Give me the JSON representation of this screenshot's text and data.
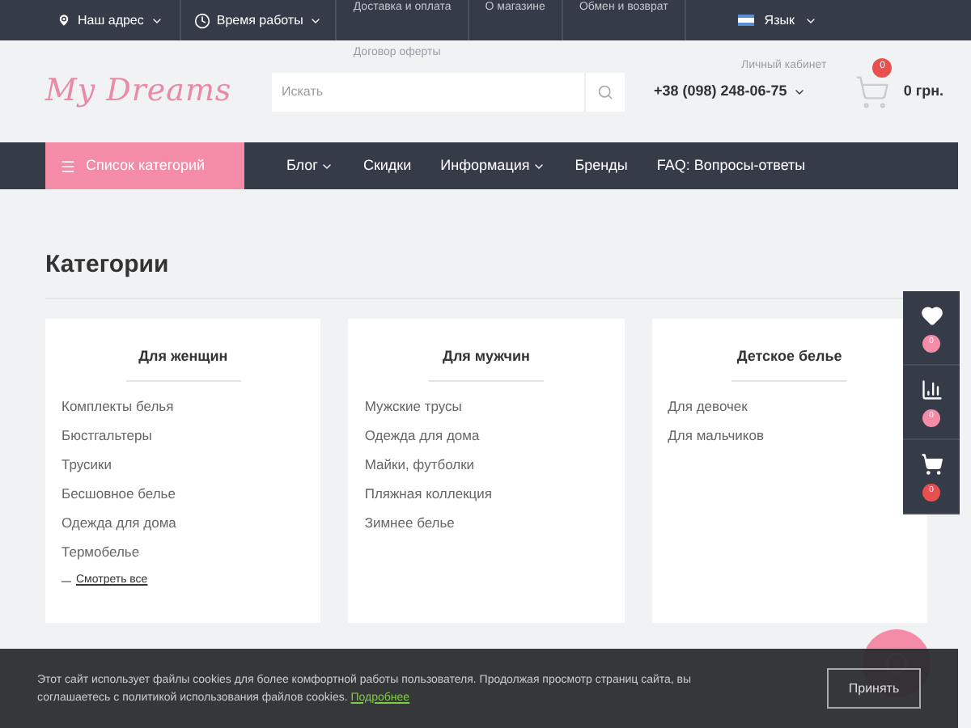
{
  "top_bar": {
    "address": "Наш адрес",
    "hours": "Время работы",
    "links": [
      "Доставка и оплата",
      "О магазине",
      "Обмен и возврат"
    ],
    "overflow_link": "Договор оферты",
    "language": "Язык"
  },
  "header": {
    "logo": "My Dreams",
    "search": {
      "placeholder": "Искать"
    },
    "account_link": "Личный кабинет",
    "phone": "+38 (098) 248-06-75",
    "cart": {
      "count": "0",
      "total": "0 грн."
    }
  },
  "nav": {
    "catalog_button": "Список категорий",
    "items": [
      {
        "label": "Блог",
        "dropdown": true
      },
      {
        "label": "Скидки",
        "dropdown": false
      },
      {
        "label": "Информация",
        "dropdown": true
      },
      {
        "label": "Бренды",
        "dropdown": false
      },
      {
        "label": "FAQ: Вопросы-ответы",
        "dropdown": false
      }
    ]
  },
  "page_title": "Категории",
  "categories": [
    {
      "title": "Для женщин",
      "items": [
        "Комплекты белья",
        "Бюстгальтеры",
        "Трусики",
        "Бесшовное белье",
        "Одежда для дома",
        "Термобелье"
      ],
      "see_all": "Смотреть все"
    },
    {
      "title": "Для мужчин",
      "items": [
        "Мужские трусы",
        "Одежда для дома",
        "Майки, футболки",
        "Пляжная коллекция",
        "Зимнее белье"
      ]
    },
    {
      "title": "Детское белье",
      "items": [
        "Для девочек",
        "Для мальчиков"
      ]
    }
  ],
  "side_panel": [
    {
      "kind": "wishlist",
      "count": "0",
      "color": "#f48ca8"
    },
    {
      "kind": "compare",
      "count": "0",
      "color": "#f48ca8"
    },
    {
      "kind": "cart",
      "count": "0",
      "color": "#e8504f"
    }
  ],
  "cookie_bar": {
    "text": "Этот сайт использует файлы cookies для более комфортной работы пользователя. Продолжая просмотр страниц сайта, вы соглашаетесь с политикой использования файлов cookies.",
    "link": "Подробнее",
    "button": "Принять"
  }
}
